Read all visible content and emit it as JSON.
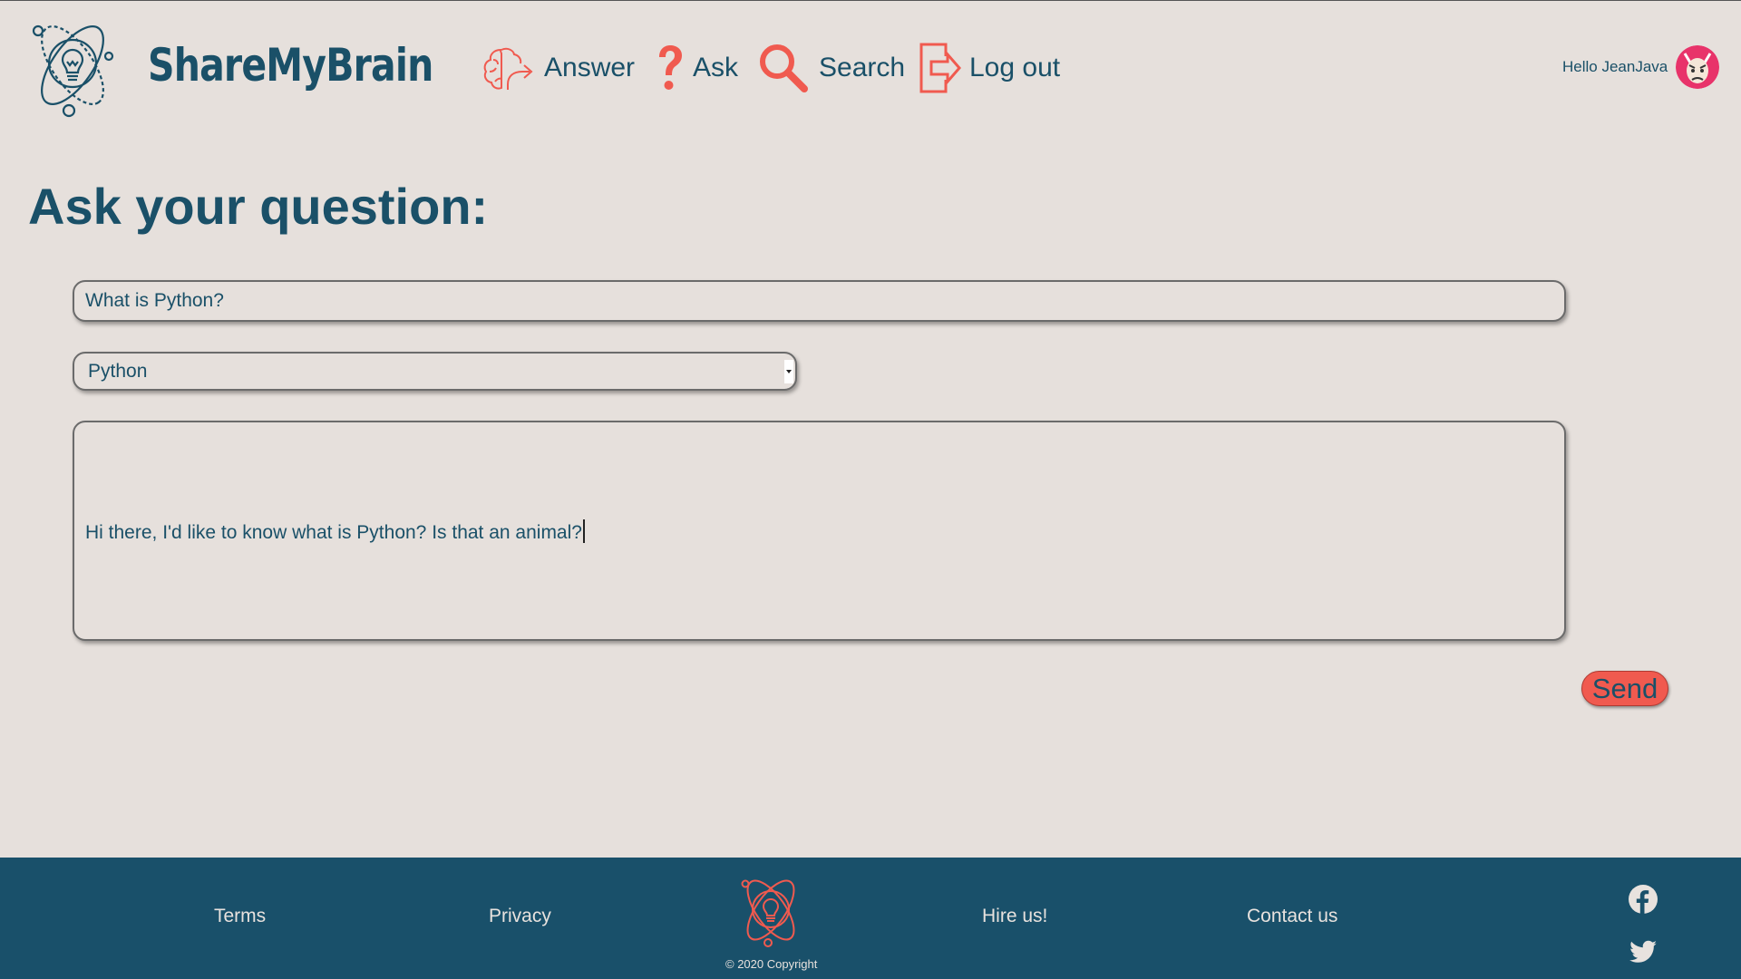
{
  "header": {
    "brand": "ShareMyBrain",
    "nav": {
      "answer": "Answer",
      "ask": "Ask",
      "search": "Search",
      "logout": "Log out"
    },
    "greeting": "Hello JeanJava"
  },
  "main": {
    "title": "Ask your question:",
    "question_title_value": "What is Python?",
    "category_selected": "Python",
    "body_value": "Hi there, I'd like to know what is Python? Is  that an animal?",
    "send_label": "Send"
  },
  "footer": {
    "links": [
      "Terms",
      "Privacy",
      "Hire us!",
      "Contact us"
    ],
    "copyright": "© 2020 Copyright",
    "social": [
      "facebook-icon",
      "twitter-icon"
    ]
  },
  "colors": {
    "background": "#e6e0dc",
    "primary_text": "#1a5068",
    "accent": "#f05a4f",
    "footer_bg": "#19506a"
  }
}
